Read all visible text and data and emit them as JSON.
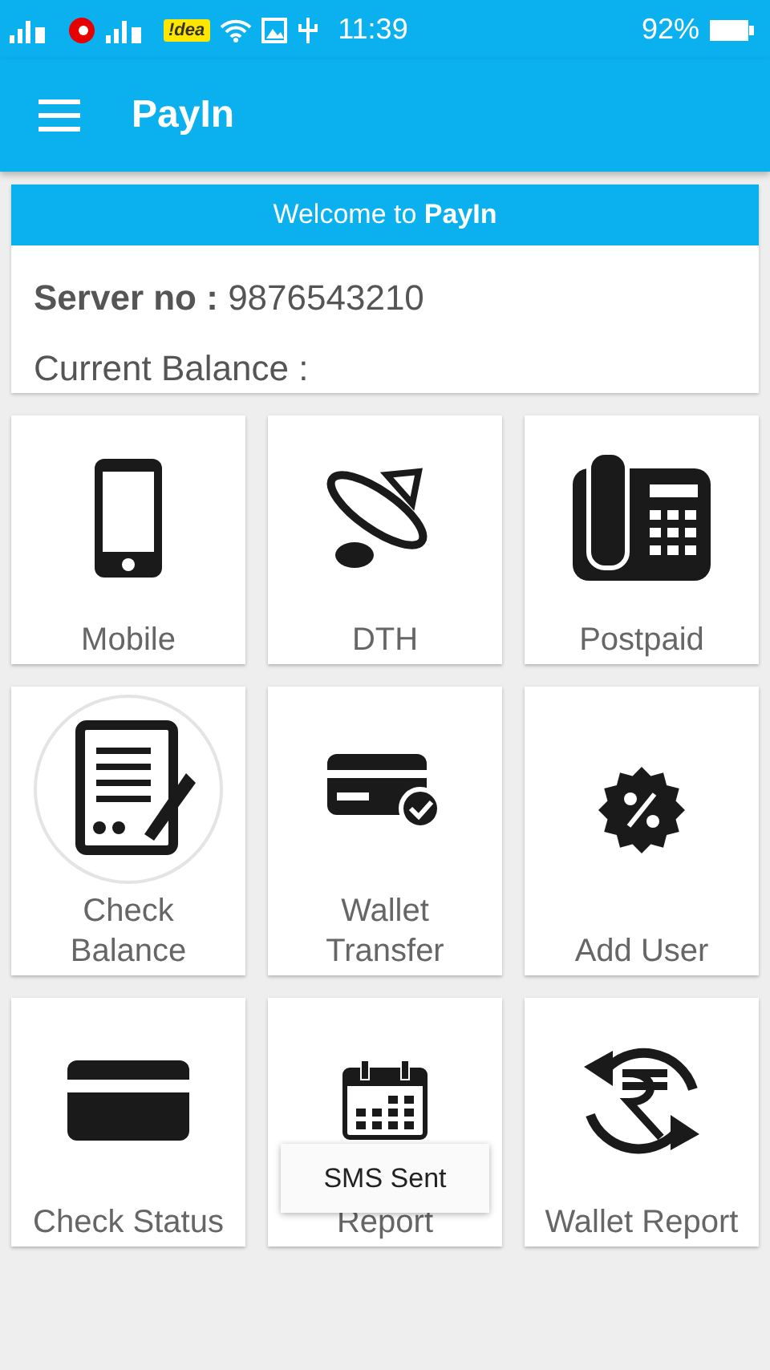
{
  "status_bar": {
    "carrier_badge": "!dea",
    "time": "11:39",
    "battery": "92%"
  },
  "app_bar": {
    "title": "PayIn"
  },
  "welcome": {
    "banner": "Welcome to **PayIn**",
    "server_label": "Server no :",
    "server_value": "9876543210",
    "balance_label": "Current Balance :"
  },
  "tiles": [
    {
      "label": "Mobile",
      "kind": "mobile"
    },
    {
      "label": "DTH",
      "kind": "dish"
    },
    {
      "label": "Postpaid",
      "kind": "phone"
    },
    {
      "label": "Check Balance",
      "kind": "document"
    },
    {
      "label": "Wallet Transfer",
      "kind": "card-check"
    },
    {
      "label": "Add User",
      "kind": "badge"
    },
    {
      "label": "Check Status",
      "kind": "card"
    },
    {
      "label": "Report",
      "kind": "calendar"
    },
    {
      "label": "Wallet Report",
      "kind": "rupee"
    }
  ],
  "toast": "SMS Sent"
}
